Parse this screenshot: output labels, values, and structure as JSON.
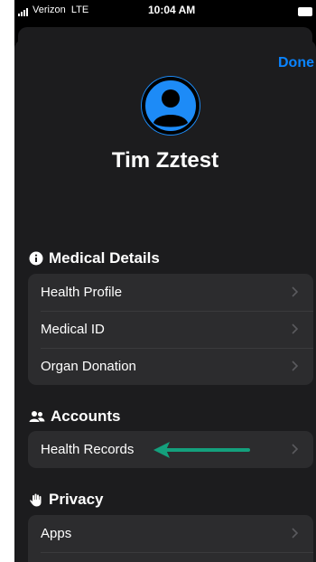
{
  "status_bar": {
    "carrier": "Verizon",
    "network": "LTE",
    "time": "10:04 AM"
  },
  "header": {
    "done_label": "Done"
  },
  "profile": {
    "name": "Tim Zztest",
    "avatar_color": "#1d8bf7"
  },
  "sections": {
    "medical": {
      "title": "Medical Details",
      "icon": "info-circle-icon",
      "items": [
        "Health Profile",
        "Medical ID",
        "Organ Donation"
      ]
    },
    "accounts": {
      "title": "Accounts",
      "icon": "people-icon",
      "items": [
        "Health Records"
      ]
    },
    "privacy": {
      "title": "Privacy",
      "icon": "hand-icon",
      "items": [
        "Apps"
      ]
    }
  },
  "colors": {
    "accent": "#0a84ff",
    "background": "#1c1c1e",
    "cell": "#2c2c2e",
    "annotation_arrow": "#14a07d"
  }
}
